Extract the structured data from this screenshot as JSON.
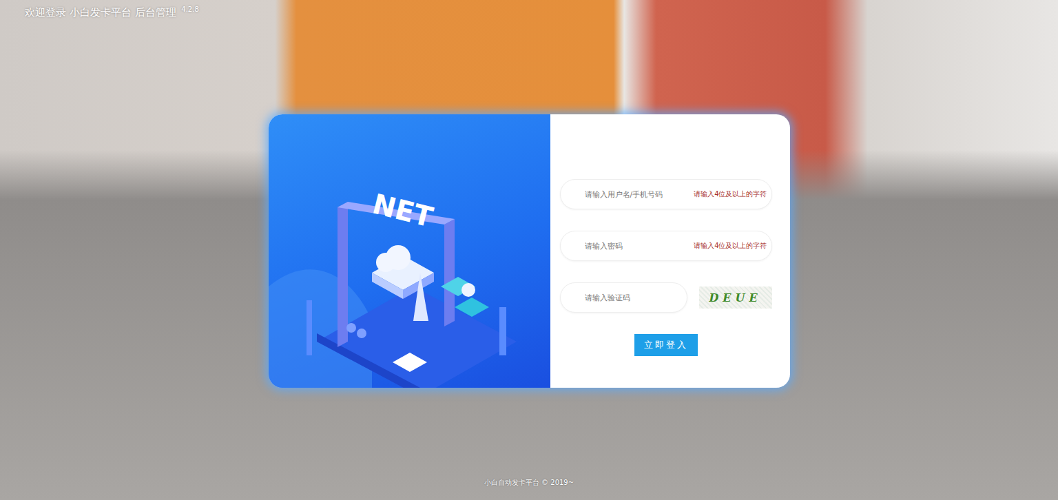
{
  "header": {
    "title": "欢迎登录 小白发卡平台 后台管理",
    "version": "4.2.8"
  },
  "illustration": {
    "label": "NET"
  },
  "form": {
    "fields": [
      {
        "kind": "text",
        "placeholder": "请输入用户名/手机号码",
        "hint": "请输入4位及以上的字符"
      },
      {
        "kind": "password",
        "placeholder": "请输入密码",
        "hint": "请输入4位及以上的字符"
      },
      {
        "kind": "captcha",
        "placeholder": "请输入验证码",
        "captcha": "DEUE"
      }
    ],
    "submit": "立即登入"
  },
  "footer": "小白自动发卡平台 © 2019~"
}
